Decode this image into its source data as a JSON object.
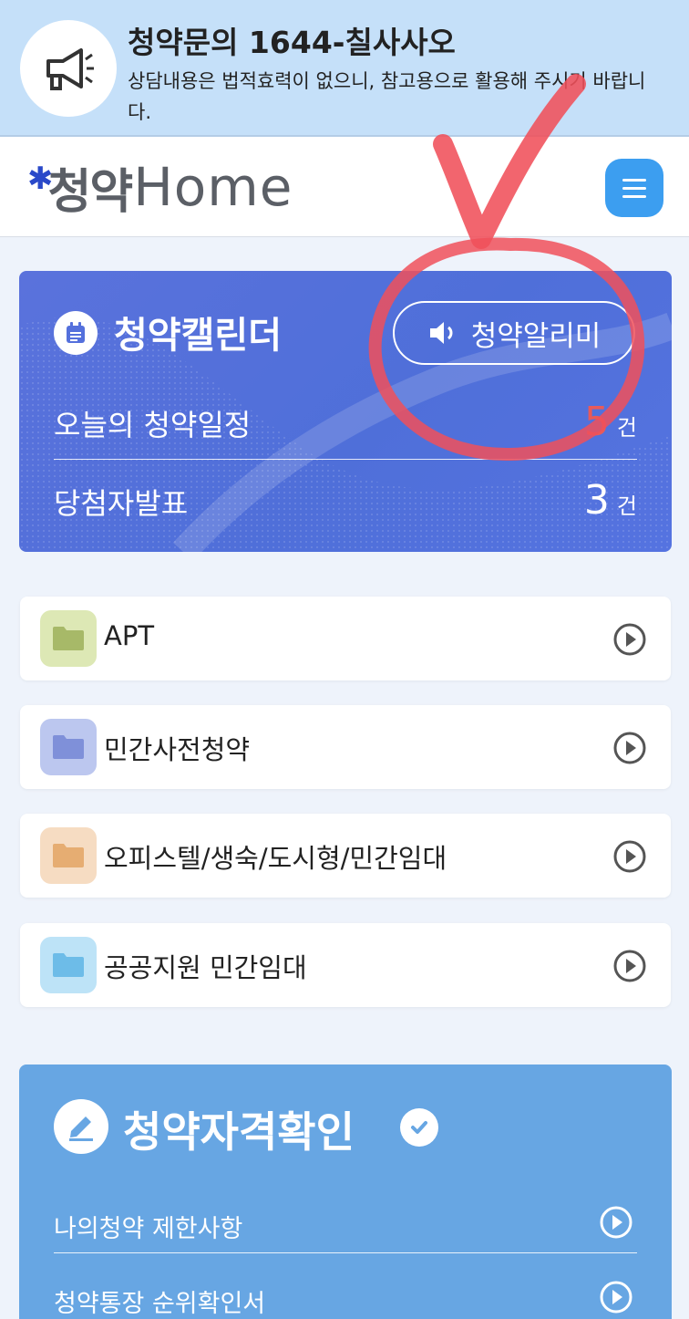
{
  "notice": {
    "title": "청약문의 1644-칠사사오",
    "desc": "상담내용은 법적효력이 없으니, 참고용으로 활용해 주시기 바랍니다."
  },
  "header": {
    "logo_kor": "청약",
    "logo_eng": "Home"
  },
  "calendar": {
    "title": "청약캘린더",
    "alarm_label": "청약알리미",
    "rows": [
      {
        "label": "오늘의 청약일정",
        "count": "5",
        "unit": "건"
      },
      {
        "label": "당첨자발표",
        "count": "3",
        "unit": "건"
      }
    ],
    "colors": {
      "count_highlight": "#e85a5a",
      "card": "#5470dc"
    }
  },
  "categories": [
    {
      "label": "APT",
      "folder_color": "#a7b968",
      "bg_color": "#dde8b5"
    },
    {
      "label": "민간사전청약",
      "folder_color": "#7f90d9",
      "bg_color": "#bcc7ef"
    },
    {
      "label": "오피스텔/생숙/도시형/민간임대",
      "folder_color": "#e6ad72",
      "bg_color": "#f6dcc2"
    },
    {
      "label": "공공지원 민간임대",
      "folder_color": "#6dbce8",
      "bg_color": "#bde3f7"
    }
  ],
  "eligibility": {
    "title": "청약자격확인",
    "rows": [
      {
        "label": "나의청약 제한사항"
      },
      {
        "label": "청약통장 순위확인서"
      }
    ]
  },
  "annotation": {
    "color": "#f0505a"
  }
}
